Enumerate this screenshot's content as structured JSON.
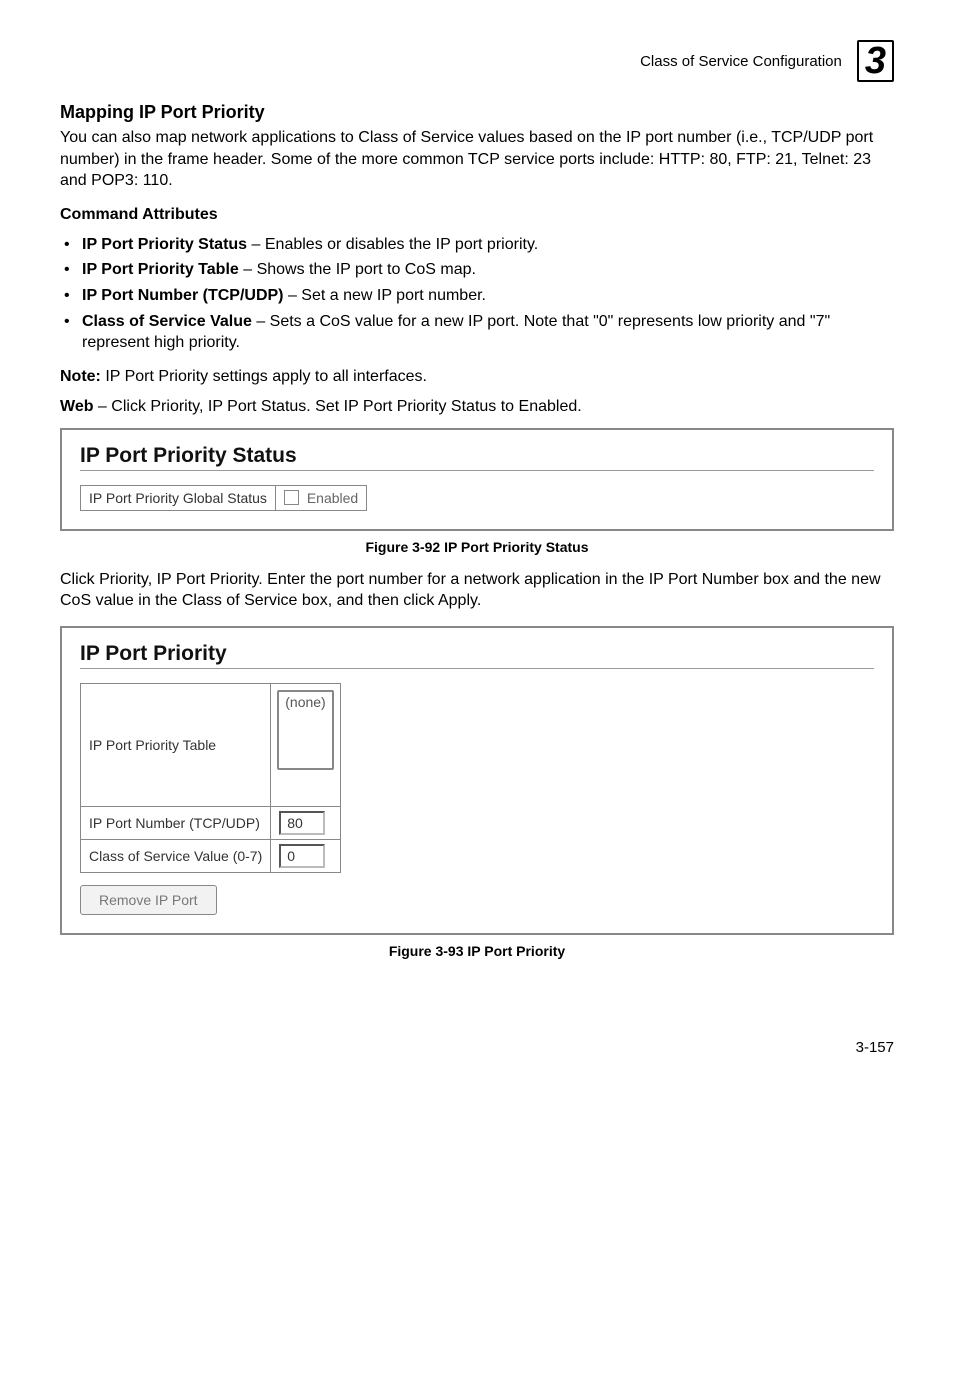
{
  "header": {
    "breadcrumb": "Class of Service Configuration",
    "chapter_number": "3"
  },
  "section1": {
    "title": "Mapping IP Port Priority",
    "intro": "You can also map network applications to Class of Service values based on the IP port number (i.e., TCP/UDP port number) in the frame header. Some of the more common TCP service ports include: HTTP: 80, FTP: 21, Telnet: 23 and POP3: 110.",
    "cmd_heading": "Command Attributes",
    "bullets": [
      {
        "label": "IP Port Priority Status",
        "rest": " – Enables or disables the IP port priority."
      },
      {
        "label": "IP Port Priority Table",
        "rest": " – Shows the IP port to CoS map."
      },
      {
        "label": "IP Port Number (TCP/UDP)",
        "rest": " – Set a new IP port number."
      },
      {
        "label": "Class of Service Value",
        "rest": " – Sets a CoS value for a new IP port. Note that \"0\" represents low priority and \"7\" represent high priority."
      }
    ],
    "note_label": "Note:",
    "note_text": "  IP Port Priority settings apply to all interfaces.",
    "web_label": "Web",
    "web_text": " – Click Priority, IP Port Status. Set IP Port Priority Status to Enabled."
  },
  "panel_status": {
    "title": "IP Port Priority Status",
    "row_label": "IP Port Priority Global Status",
    "checkbox_label": " Enabled"
  },
  "fig92_caption": "Figure 3-92   IP Port Priority Status",
  "between_text": "Click Priority, IP Port Priority. Enter the port number for a network application in the IP Port Number box and the new CoS value in the Class of Service box, and then click Apply.",
  "panel_priority": {
    "title": "IP Port Priority",
    "row1_label": "IP Port Priority Table",
    "row1_value": "(none)",
    "row2_label": "IP Port Number (TCP/UDP)",
    "row2_value": "80",
    "row3_label": "Class of Service Value (0-7)",
    "row3_value": "0",
    "button_label": "Remove IP Port"
  },
  "fig93_caption": "Figure 3-93   IP Port Priority",
  "page_number": "3-157"
}
